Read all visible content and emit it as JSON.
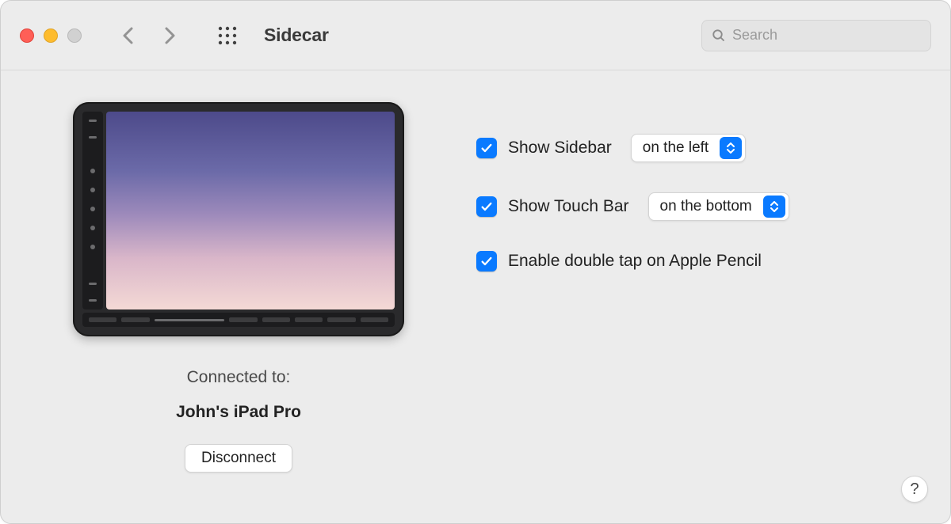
{
  "toolbar": {
    "title": "Sidecar",
    "search_placeholder": "Search"
  },
  "device": {
    "connected_label": "Connected to:",
    "name": "John's iPad Pro",
    "disconnect_label": "Disconnect"
  },
  "options": {
    "show_sidebar": {
      "label": "Show Sidebar",
      "value": "on the left",
      "checked": true
    },
    "show_touchbar": {
      "label": "Show Touch Bar",
      "value": "on the bottom",
      "checked": true
    },
    "double_tap": {
      "label": "Enable double tap on Apple Pencil",
      "checked": true
    }
  },
  "help": {
    "label": "?"
  }
}
